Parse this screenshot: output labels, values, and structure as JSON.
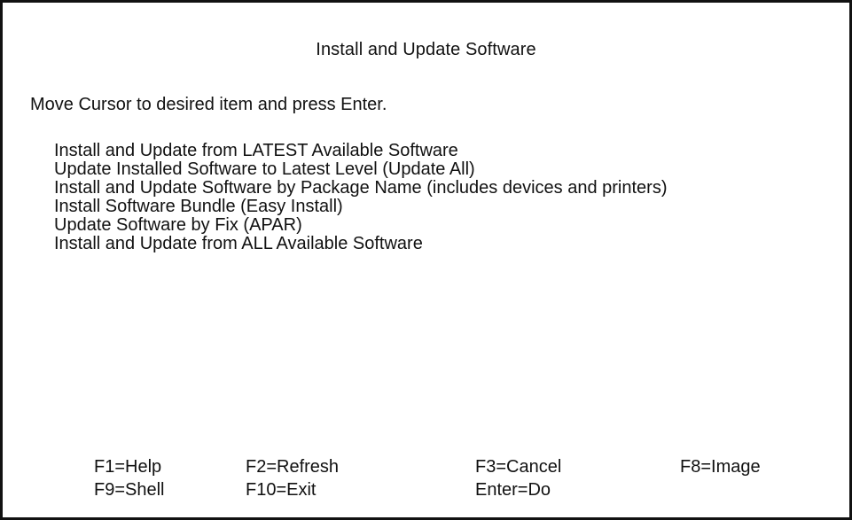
{
  "screen": {
    "title": "Install and Update Software",
    "instruction": "Move Cursor to desired item and press Enter."
  },
  "menu": {
    "items": [
      {
        "label": "Install and Update from LATEST Available Software"
      },
      {
        "label": "Update Installed Software to Latest Level (Update All)"
      },
      {
        "label": "Install and Update Software by Package Name (includes devices and printers)"
      },
      {
        "label": "Install Software Bundle (Easy Install)"
      },
      {
        "label": "Update Software by Fix (APAR)"
      },
      {
        "label": "Install and Update from ALL Available Software"
      }
    ]
  },
  "function_keys": {
    "f1": "F1=Help",
    "f2": "F2=Refresh",
    "f3": "F3=Cancel",
    "f8": "F8=Image",
    "f9": "F9=Shell",
    "f10": "F10=Exit",
    "enter": "Enter=Do"
  }
}
